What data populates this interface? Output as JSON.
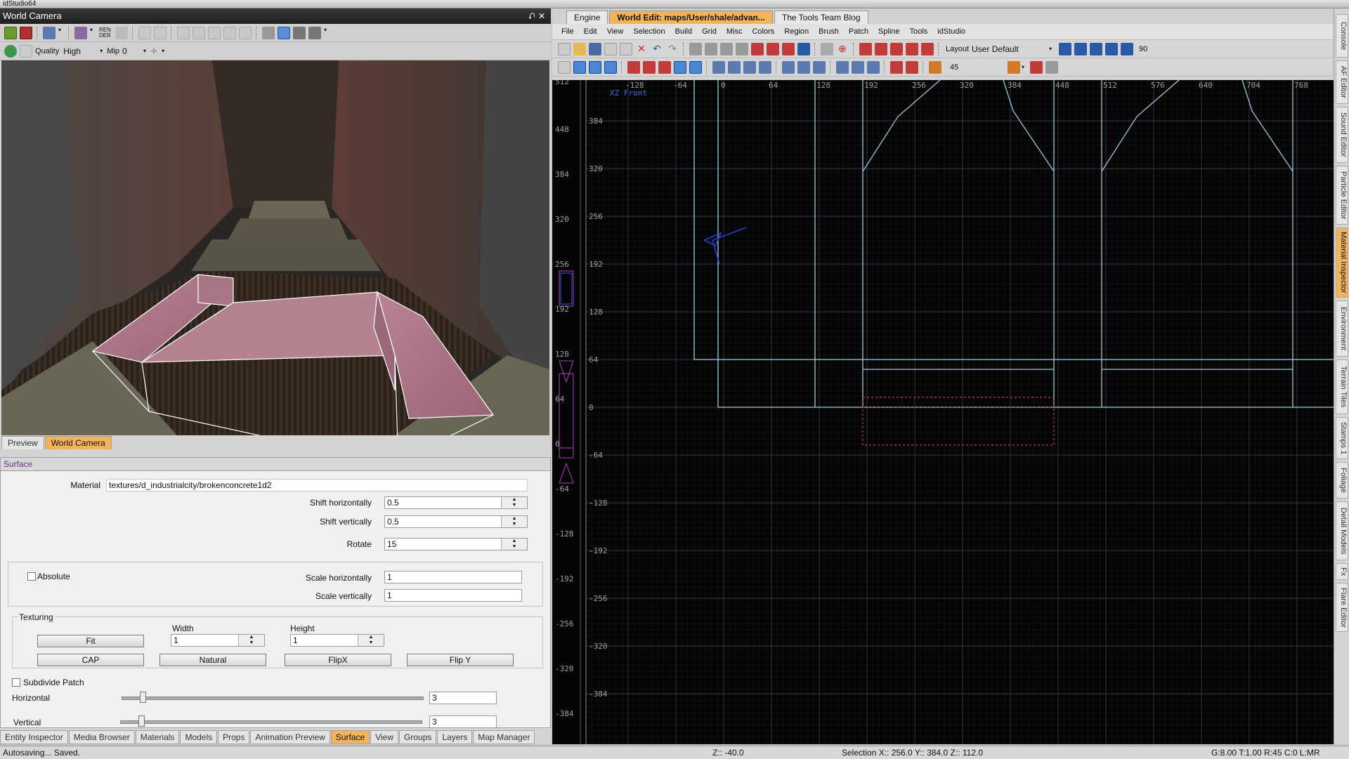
{
  "app": {
    "title": "idStudio64"
  },
  "world_camera": {
    "title": "World Camera",
    "pin": "⮏",
    "close": "✕",
    "quality_label": "Quality",
    "quality_value": "High",
    "mip_label": "Mip",
    "mip_value": "0",
    "render_label": "REN\nDER",
    "tabs": [
      {
        "label": "Preview"
      },
      {
        "label": "World Camera"
      }
    ]
  },
  "surface": {
    "title": "Surface",
    "material_label": "Material",
    "material_value": "textures/d_industrialcity/brokenconcrete1d2",
    "shift_h_label": "Shift horizontally",
    "shift_h_value": "0.5",
    "shift_v_label": "Shift vertically",
    "shift_v_value": "0.5",
    "rotate_label": "Rotate",
    "rotate_value": "15",
    "absolute_label": "Absolute",
    "scale_h_label": "Scale horizontally",
    "scale_h_value": "1",
    "scale_v_label": "Scale vertically",
    "scale_v_value": "1",
    "texturing_label": "Texturing",
    "width_label": "Width",
    "width_value": "1",
    "height_label": "Height",
    "height_value": "1",
    "fit_label": "Fit",
    "cap_label": "CAP",
    "natural_label": "Natural",
    "flipx_label": "FlipX",
    "flipy_label": "Flip Y",
    "subdivide_label": "Subdivide Patch",
    "horizontal_label": "Horizontal",
    "horizontal_value": "3",
    "vertical_label": "Vertical",
    "vertical_value": "3"
  },
  "bottom_tabs": [
    {
      "label": "Entity Inspector"
    },
    {
      "label": "Media Browser"
    },
    {
      "label": "Materials"
    },
    {
      "label": "Models"
    },
    {
      "label": "Props"
    },
    {
      "label": "Animation Preview"
    },
    {
      "label": "Surface"
    },
    {
      "label": "View"
    },
    {
      "label": "Groups"
    },
    {
      "label": "Layers"
    },
    {
      "label": "Map Manager"
    }
  ],
  "editor": {
    "doc_tabs": [
      {
        "label": "Engine"
      },
      {
        "label": "World Edit: maps/User/shale/advan..."
      },
      {
        "label": "The Tools Team Blog"
      }
    ],
    "menus": [
      "File",
      "Edit",
      "View",
      "Selection",
      "Build",
      "Grid",
      "Misc",
      "Colors",
      "Region",
      "Brush",
      "Patch",
      "Spline",
      "Tools",
      "idStudio"
    ],
    "layout_label": "Layout",
    "layout_value": "User Default",
    "angle_value": "90",
    "grid_value": "45",
    "view_label": "XZ Front",
    "x_ticks": [
      "-128",
      "-64",
      "0",
      "64",
      "128",
      "192",
      "256",
      "320",
      "384",
      "448",
      "512",
      "576",
      "640",
      "704",
      "768"
    ],
    "y_ticks": [
      "384",
      "320",
      "256",
      "192",
      "128",
      "64",
      "0",
      "-64",
      "-128",
      "-192",
      "-256",
      "-320",
      "-384"
    ],
    "z_ticks": [
      "512",
      "448",
      "384",
      "320",
      "256",
      "192",
      "128",
      "64",
      "0",
      "-64",
      "-128",
      "-192",
      "-256",
      "-320",
      "-384"
    ]
  },
  "right_dock": [
    {
      "label": "Console"
    },
    {
      "label": "AF Editor"
    },
    {
      "label": "Sound Editor"
    },
    {
      "label": "Particle Editor"
    },
    {
      "label": "Material Inspector"
    },
    {
      "label": "Environment"
    },
    {
      "label": "Terrain Tiles"
    },
    {
      "label": "Stamps 1"
    },
    {
      "label": "Foliage"
    },
    {
      "label": "Detail Models"
    },
    {
      "label": "Fx"
    },
    {
      "label": "Flare Editor"
    }
  ],
  "status": {
    "left": "Autosaving... Saved.",
    "z": "Z:: -40.0",
    "selection": "Selection X:: 256.0  Y:: 384.0  Z:: 112.0",
    "right": "G:8.00 T:1.00 R:45 C:0 L:MR"
  }
}
